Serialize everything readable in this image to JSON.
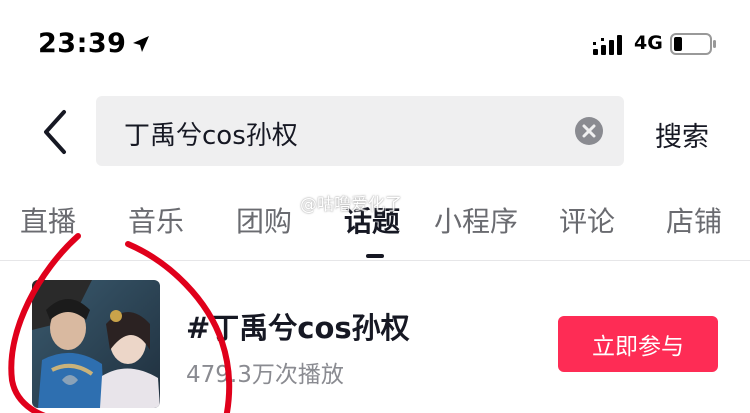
{
  "status_bar": {
    "time": "23:39",
    "network": "4G"
  },
  "header": {
    "search_query": "丁禹兮cos孙权",
    "search_button": "搜索"
  },
  "tabs": [
    {
      "label": "直播"
    },
    {
      "label": "音乐"
    },
    {
      "label": "团购"
    },
    {
      "label": "话题"
    },
    {
      "label": "小程序"
    },
    {
      "label": "评论"
    },
    {
      "label": "店铺"
    }
  ],
  "active_tab": "话题",
  "result": {
    "title": "#丁禹兮cos孙权",
    "plays": "479.3万次播放",
    "action": "立即参与"
  },
  "watermark": "@咕噜爱化了",
  "colors": {
    "accent": "#fe2c55",
    "annotation": "#e0001b"
  },
  "icons": [
    "location-arrow-icon",
    "signal-icon",
    "battery-icon",
    "back-chevron-icon",
    "clear-icon"
  ]
}
